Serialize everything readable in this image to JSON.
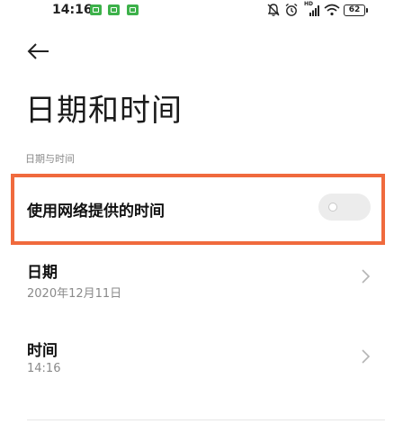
{
  "status_bar": {
    "time": "14:16",
    "battery_level": "62",
    "network_label": "HD",
    "icons": [
      "notification-icon",
      "notification-icon",
      "notification-icon",
      "mute-icon",
      "alarm-icon",
      "signal-icon",
      "wifi-icon",
      "battery-icon"
    ],
    "notification_color": "#3db14a"
  },
  "header": {
    "back_icon": "back-arrow-icon",
    "title": "日期和时间"
  },
  "section": {
    "label": "日期与时间"
  },
  "settings": {
    "network_time": {
      "label": "使用网络提供的时间",
      "toggle_on": false
    },
    "date": {
      "label": "日期",
      "value": "2020年12月11日"
    },
    "time": {
      "label": "时间",
      "value": "14:16"
    }
  },
  "colors": {
    "highlight": "#f06a3d",
    "toggle_track": "#ececec",
    "secondary_text": "#8a8a8a"
  }
}
